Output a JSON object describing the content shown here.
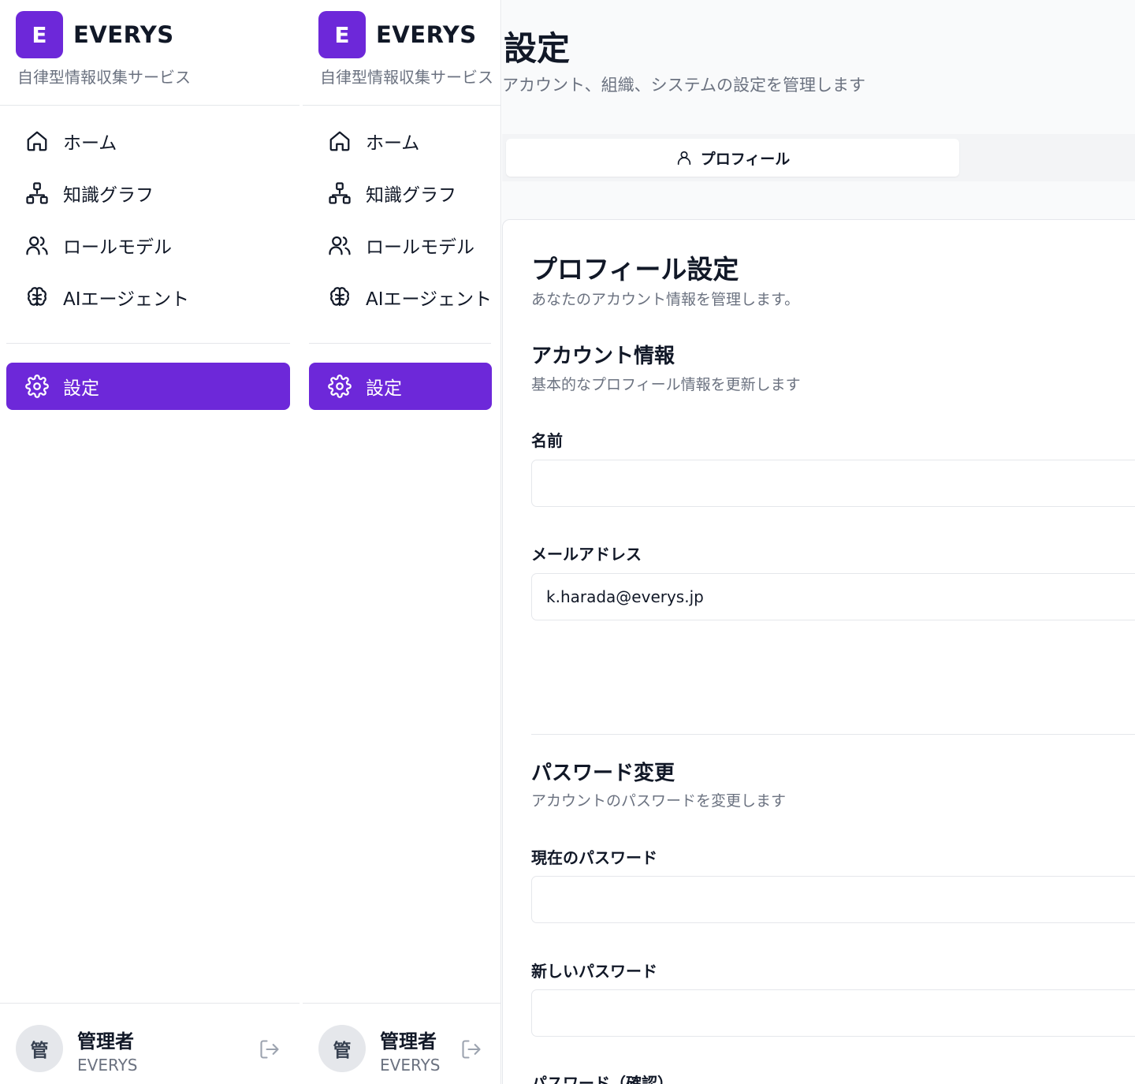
{
  "brand": {
    "logo_letter": "E",
    "name": "EVERYS",
    "subtitle": "自律型情報収集サービス"
  },
  "nav": {
    "items": [
      {
        "label": "ホーム",
        "icon": "home-icon"
      },
      {
        "label": "知識グラフ",
        "icon": "network-icon"
      },
      {
        "label": "ロールモデル",
        "icon": "users-icon"
      },
      {
        "label": "AIエージェント",
        "icon": "brain-icon"
      }
    ],
    "active": {
      "label": "設定",
      "icon": "gear-icon"
    }
  },
  "user": {
    "avatar_initial": "管",
    "name": "管理者",
    "org": "EVERYS"
  },
  "page": {
    "title": "設定",
    "subtitle": "アカウント、組織、システムの設定を管理します"
  },
  "tabs": {
    "active_label": "プロフィール"
  },
  "profile": {
    "title": "プロフィール設定",
    "subtitle": "あなたのアカウント情報を管理します。",
    "account": {
      "title": "アカウント情報",
      "subtitle": "基本的なプロフィール情報を更新します",
      "name_label": "名前",
      "name_value": "",
      "email_label": "メールアドレス",
      "email_value": "k.harada@everys.jp"
    },
    "password": {
      "title": "パスワード変更",
      "subtitle": "アカウントのパスワードを変更します",
      "current_label": "現在のパスワード",
      "new_label": "新しいパスワード",
      "confirm_label": "パスワード（確認）"
    }
  },
  "colors": {
    "accent": "#6d28d9",
    "border": "#e5e7eb",
    "muted_text": "#6b7280"
  }
}
